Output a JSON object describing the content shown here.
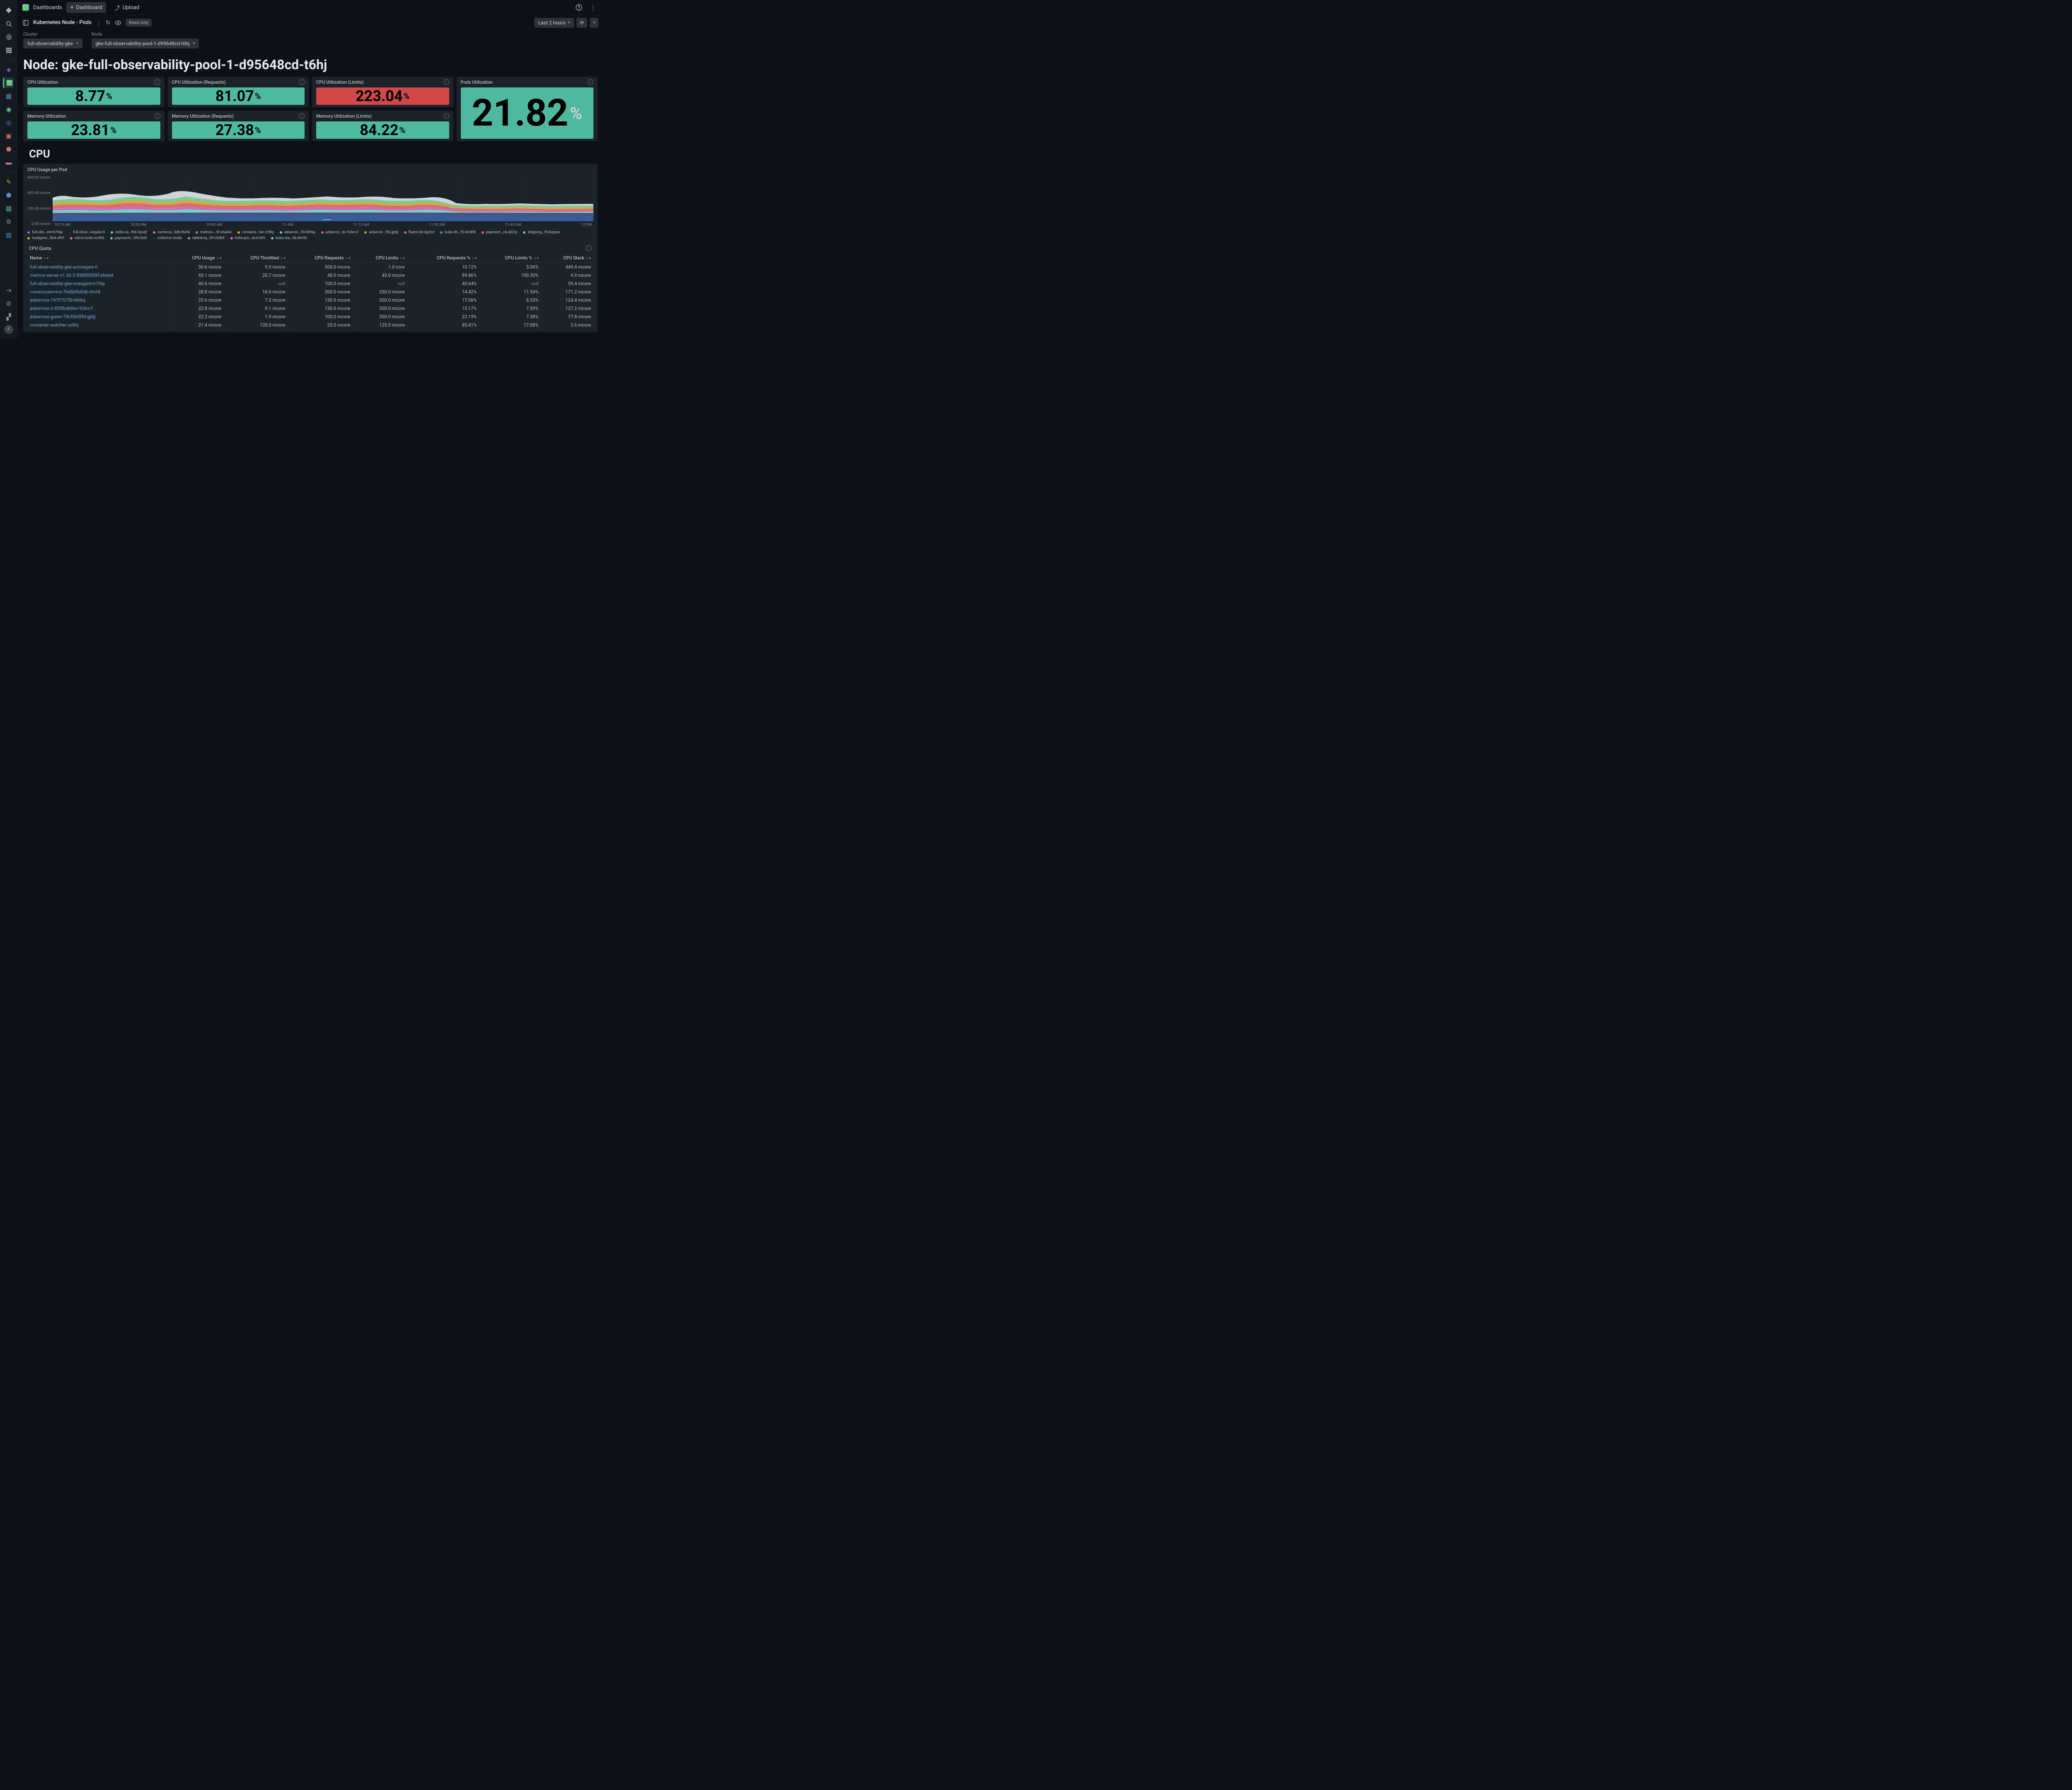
{
  "topbar": {
    "dashboards": "Dashboards",
    "new_dashboard": "Dashboard",
    "upload": "Upload"
  },
  "toolbar": {
    "title": "Kubernetes Node - Pods",
    "readonly": "Read only",
    "timerange": "Last 2 hours"
  },
  "filters": {
    "cluster_label": "Cluster",
    "cluster_value": "full-observability-gke",
    "node_label": "Node",
    "node_value": "gke-full-observability-pool-1-d95648cd-t6hj"
  },
  "page_title": "Node: gke-full-observability-pool-1-d95648cd-t6hj",
  "cards": [
    {
      "title": "CPU Utilization",
      "value": "8.77",
      "color": "green"
    },
    {
      "title": "CPU Utilization (Requests)",
      "value": "81.07",
      "color": "green"
    },
    {
      "title": "CPU Utilization (Limits)",
      "value": "223.04",
      "color": "red"
    },
    {
      "title": "Memory Utilization",
      "value": "23.81",
      "color": "green"
    },
    {
      "title": "Memory Utilization (Requests)",
      "value": "27.38",
      "color": "green"
    },
    {
      "title": "Memory Utilization (Limits)",
      "value": "84.22",
      "color": "green"
    }
  ],
  "pods_card": {
    "title": "Pods Utilization",
    "value": "21.82"
  },
  "section_cpu": "CPU",
  "chart": {
    "title": "CPU Usage per Pod",
    "y_ticks": [
      "600.00 mcore",
      "400.00 mcore",
      "200.00 mcore",
      "0.00 mcore"
    ],
    "x_ticks": [
      "10:15 AM",
      "10:30 AM",
      "10:45 AM",
      "11 AM",
      "11:15 AM",
      "11:30 AM",
      "11:45 AM",
      "12 PM"
    ]
  },
  "legend": [
    {
      "c": "#5b8dd6",
      "t": "full-obs…ent-h7f4p"
    },
    {
      "c": "#2a2e36",
      "t": "full-obse…ivegate-0"
    },
    {
      "c": "#6ecf9a",
      "t": "redis-ca…fbb-2psqf"
    },
    {
      "c": "#d66fb1",
      "t": "currency…5db-tbvf4"
    },
    {
      "c": "#8a9099",
      "t": "metrics-…9f-z6wb4"
    },
    {
      "c": "#d9a648",
      "t": "containe…her-zz8lq"
    },
    {
      "c": "#6fd1d6",
      "t": "adservic…59-l6h6q"
    },
    {
      "c": "#c56f6f",
      "t": "adservic…6c-92km7"
    },
    {
      "c": "#8fb851",
      "t": "adservic…ffd-gjldj"
    },
    {
      "c": "#d66f6f",
      "t": "fluent-bit-4g2zd"
    },
    {
      "c": "#5b8dd6",
      "t": "kube-dn…f5-4m8f8"
    },
    {
      "c": "#d66f6f",
      "t": "payment…c6-4j57p"
    },
    {
      "c": "#6ecf9a",
      "t": "shipping…f5-6qnpw"
    },
    {
      "c": "#d9a648",
      "t": "loadgene…5b4-xflvf"
    },
    {
      "c": "#d66fb1",
      "t": "ndcsi-node-mvfb6"
    },
    {
      "c": "#6ecf9a",
      "t": "payments…5f6-6ixlt"
    },
    {
      "c": "#2a2e36",
      "t": "collector-sinda"
    },
    {
      "c": "#8a9099",
      "t": "rabbitmq…89-2td84"
    },
    {
      "c": "#d66fb1",
      "t": "kube-pro…8cd-t6hi"
    },
    {
      "c": "#6fd1d6",
      "t": "kube-sta…56-dtv96"
    }
  ],
  "quota": {
    "title": "CPU Quota",
    "cols": [
      "Name",
      "CPU Usage",
      "CPU Throttled",
      "CPU Requests",
      "CPU Limits",
      "CPU Requests %",
      "CPU Limits %",
      "CPU Slack"
    ],
    "rows": [
      {
        "name": "full-observability-gke-activegate-0",
        "v": [
          "50.6 mcore",
          "9.0 mcore",
          "500.0 mcore",
          "1.0 core",
          "10.12%",
          "5.06%",
          "449.4 mcore"
        ]
      },
      {
        "name": "metrics-server-v1.30.3-5988ffd59f-z6wb4",
        "v": [
          "43.1 mcore",
          "20.7 mcore",
          "48.0 mcore",
          "43.0 mcore",
          "89.86%",
          "100.30%",
          "4.9 mcore"
        ]
      },
      {
        "name": "full-observability-gke-oneagent-h7f4p",
        "v": [
          "40.6 mcore",
          "null",
          "100.0 mcore",
          "null",
          "40.64%",
          "null",
          "59.4 mcore"
        ]
      },
      {
        "name": "currencyservice-7bd8d5d5db-tbvf4",
        "v": [
          "28.8 mcore",
          "16.6 mcore",
          "200.0 mcore",
          "250.0 mcore",
          "14.42%",
          "11.54%",
          "171.2 mcore"
        ]
      },
      {
        "name": "adservice-747f75759-l6h6q",
        "v": [
          "25.6 mcore",
          "7.3 mcore",
          "150.0 mcore",
          "300.0 mcore",
          "17.06%",
          "8.53%",
          "124.4 mcore"
        ]
      },
      {
        "name": "adservice-2-85ffbd686c-92km7",
        "v": [
          "22.8 mcore",
          "9.1 mcore",
          "150.0 mcore",
          "300.0 mcore",
          "15.17%",
          "7.59%",
          "127.2 mcore"
        ]
      },
      {
        "name": "adservice-green-79cf665ffd-gjldj",
        "v": [
          "22.2 mcore",
          "1.9 mcore",
          "100.0 mcore",
          "300.0 mcore",
          "22.15%",
          "7.38%",
          "77.8 mcore"
        ]
      },
      {
        "name": "container-watcher-zz8lq",
        "v": [
          "21.4 mcore",
          "135.0 mcore",
          "25.0 mcore",
          "125.0 mcore",
          "85.41%",
          "17.08%",
          "3.6 mcore"
        ]
      }
    ]
  },
  "chart_data": {
    "type": "area-stacked",
    "title": "CPU Usage per Pod",
    "ylabel": "mcore",
    "ylim": [
      0,
      600
    ],
    "x": [
      "10:15",
      "10:30",
      "10:45",
      "11:00",
      "11:15",
      "11:30",
      "11:45",
      "12:00"
    ],
    "total_top": [
      520,
      470,
      500,
      560,
      430,
      420,
      440,
      410,
      400,
      415,
      405,
      395,
      390,
      410,
      405,
      400
    ],
    "note": "stacked area of per-pod CPU; individual series not readable from pixels"
  }
}
